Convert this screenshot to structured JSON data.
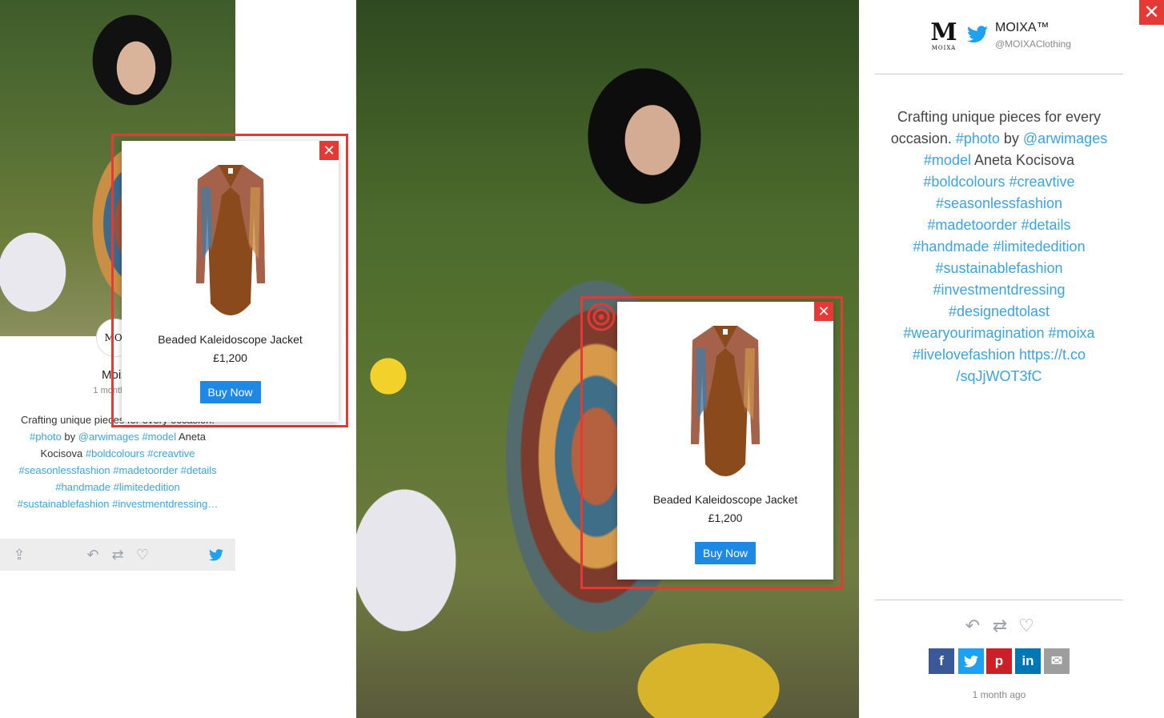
{
  "brand": {
    "name": "MOIXA™",
    "handle": "@MOIXAClothing",
    "logo_letter": "M",
    "logo_word": "MOIXA"
  },
  "left_card": {
    "avatar_text": "MOI",
    "name": "Moixa",
    "time": "1 month ago",
    "caption": {
      "t1": "Crafting unique pieces for every occasion.",
      "photo": "#photo",
      "by": " by ",
      "arwimages": "@arwimages",
      "model": "#model",
      "aneta": " Aneta Kocisova ",
      "boldcolours": "#boldcolours",
      "creavtive": "#creavtive",
      "seasonless": "#seasonlessfashion",
      "madetoorder": "#madetoorder",
      "details": "#details",
      "handmade": "#handmade",
      "limited": "#limitededition",
      "sustainable": "#sustainablefashion",
      "investment": "#investmentdressing…"
    }
  },
  "popup_left": {
    "product_name": "Beaded Kaleidoscope Jacket",
    "price": "£1,200",
    "buy_label": "Buy Now",
    "close": "✕"
  },
  "popup_main": {
    "product_name": "Beaded Kaleidoscope Jacket",
    "price": "£1,200",
    "buy_label": "Buy Now",
    "close": "✕"
  },
  "right_panel": {
    "caption": {
      "t1": "Crafting unique pieces for every occasion. ",
      "photo": "#photo",
      "by": " by ",
      "arwimages": "@arwimages",
      "model": "#model",
      "aneta": " Aneta Kocisova",
      "boldcolours": "#boldcolours",
      "creavtive": "#creavtive",
      "seasonless": "#seasonlessfashion",
      "madetoorder": "#madetoorder",
      "details": "#details",
      "handmade": "#handmade",
      "limited": "#limitededition",
      "sustainable": "#sustainablefashion",
      "investment": "#investmentdressing",
      "designed": "#designedtolast",
      "wear": "#wearyourimagination",
      "moixa": "#moixa",
      "livelove": "#livelovefashion",
      "link": "https://t.co /sqJjWOT3fC"
    },
    "time": "1 month ago",
    "close": "✕"
  },
  "share_buttons": [
    {
      "name": "facebook",
      "glyph": "f",
      "color": "#3b5998"
    },
    {
      "name": "twitter",
      "glyph": "t",
      "color": "#1da1f2"
    },
    {
      "name": "pinterest",
      "glyph": "p",
      "color": "#cb2027"
    },
    {
      "name": "linkedin",
      "glyph": "in",
      "color": "#0077b5"
    },
    {
      "name": "email",
      "glyph": "✉",
      "color": "#9e9e9e"
    }
  ],
  "icons": {
    "reply": "↶",
    "retweet": "⇄",
    "like": "♡",
    "share": "⇪",
    "twitter": "twitter-bird-icon"
  },
  "colors": {
    "accent_red": "#e53935",
    "link_blue": "#3aa4e0",
    "buy_blue": "#1e88e5"
  }
}
